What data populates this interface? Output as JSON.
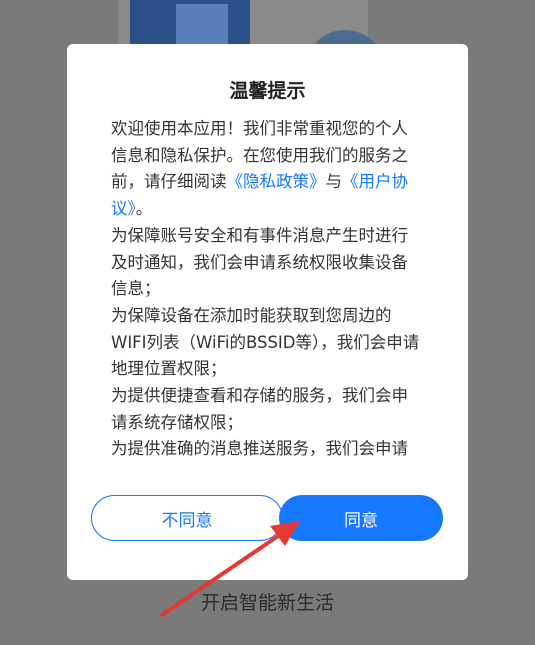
{
  "background": {
    "slogan": "开启智能新生活"
  },
  "dialog": {
    "title": "温馨提示",
    "intro_before": "欢迎使用本应用！我们非常重视您的个人信息和隐私保护。在您使用我们的服务之前，请仔细阅读",
    "privacy_link": "《隐私政策》",
    "and_text": "与",
    "agreement_link": "《用户协议》",
    "intro_after": "。",
    "paragraphs": [
      "为保障账号安全和有事件消息产生时进行及时通知，我们会申请系统权限收集设备信息；",
      "为保障设备在添加时能获取到您周边的WIFI列表（WiFi的BSSID等），我们会申请地理位置权限；",
      "为提供便捷查看和存储的服务，我们会申请系统存储权限；",
      "为提供准确的消息推送服务，我们会申请"
    ],
    "disagree_label": "不同意",
    "agree_label": "同意"
  },
  "annotation": {
    "arrow_color": "#e53935"
  },
  "colors": {
    "accent": "#1677ff",
    "overlay": "#7a7a7a"
  }
}
